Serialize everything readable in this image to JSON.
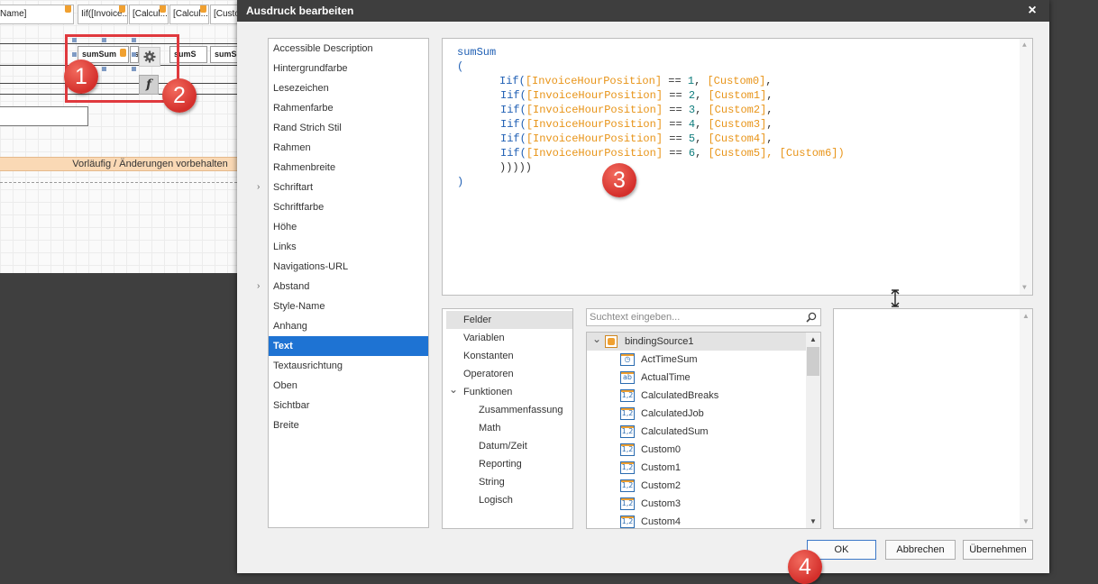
{
  "designer": {
    "header_cells": [
      "Name]",
      "Iif([Invoice...",
      "[Calcul...",
      "[Calcul...",
      "[Custo..."
    ],
    "detail_cells": [
      "sumSum",
      "s",
      "sumS",
      "sumS"
    ],
    "status_text": "Vorläufig / Änderungen vorbehalten",
    "func_label": "f"
  },
  "badges": [
    "1",
    "2",
    "3",
    "4"
  ],
  "dialog": {
    "title": "Ausdruck bearbeiten",
    "close_glyph": "×",
    "properties": [
      {
        "label": "Accessible Description",
        "expandable": false
      },
      {
        "label": "Hintergrundfarbe",
        "expandable": false
      },
      {
        "label": "Lesezeichen",
        "expandable": false
      },
      {
        "label": "Rahmenfarbe",
        "expandable": false
      },
      {
        "label": "Rand Strich Stil",
        "expandable": false
      },
      {
        "label": "Rahmen",
        "expandable": false
      },
      {
        "label": "Rahmenbreite",
        "expandable": false
      },
      {
        "label": "Schriftart",
        "expandable": true
      },
      {
        "label": "Schriftfarbe",
        "expandable": false
      },
      {
        "label": "Höhe",
        "expandable": false
      },
      {
        "label": "Links",
        "expandable": false
      },
      {
        "label": "Navigations-URL",
        "expandable": false
      },
      {
        "label": "Abstand",
        "expandable": true
      },
      {
        "label": "Style-Name",
        "expandable": false
      },
      {
        "label": "Anhang",
        "expandable": false
      },
      {
        "label": "Text",
        "expandable": false,
        "selected": true
      },
      {
        "label": "Textausrichtung",
        "expandable": false
      },
      {
        "label": "Oben",
        "expandable": false
      },
      {
        "label": "Sichtbar",
        "expandable": false
      },
      {
        "label": "Breite",
        "expandable": false
      }
    ],
    "expression": {
      "func_name": "sumSum",
      "open_paren": "(",
      "close_paren": ")",
      "iif_keyword": "Iif(",
      "position_field": "[InvoiceHourPosition]",
      "operator": " == ",
      "rows": [
        {
          "n": "1",
          "value": "[Custom0]",
          "suffix": ","
        },
        {
          "n": "2",
          "value": "[Custom1]",
          "suffix": ","
        },
        {
          "n": "3",
          "value": "[Custom2]",
          "suffix": ","
        },
        {
          "n": "4",
          "value": "[Custom3]",
          "suffix": ","
        },
        {
          "n": "5",
          "value": "[Custom4]",
          "suffix": ","
        },
        {
          "n": "6",
          "value": "[Custom5]",
          "suffix": ", [Custom6])"
        }
      ],
      "closing": ")))))"
    },
    "categories": [
      {
        "label": "Felder",
        "indent": 0,
        "selected": true
      },
      {
        "label": "Variablen",
        "indent": 0
      },
      {
        "label": "Konstanten",
        "indent": 0
      },
      {
        "label": "Operatoren",
        "indent": 0
      },
      {
        "label": "Funktionen",
        "indent": 0,
        "expanded": true
      },
      {
        "label": "Zusammenfassung",
        "indent": 1
      },
      {
        "label": "Math",
        "indent": 1
      },
      {
        "label": "Datum/Zeit",
        "indent": 1
      },
      {
        "label": "Reporting",
        "indent": 1
      },
      {
        "label": "String",
        "indent": 1
      },
      {
        "label": "Logisch",
        "indent": 1
      }
    ],
    "search": {
      "placeholder": "Suchtext eingeben..."
    },
    "tree": {
      "root": "bindingSource1",
      "fields": [
        {
          "label": "ActTimeSum",
          "icon": "clock"
        },
        {
          "label": "ActualTime",
          "icon": "ab"
        },
        {
          "label": "CalculatedBreaks",
          "icon": "1,2"
        },
        {
          "label": "CalculatedJob",
          "icon": "1,2"
        },
        {
          "label": "CalculatedSum",
          "icon": "1,2"
        },
        {
          "label": "Custom0",
          "icon": "1,2"
        },
        {
          "label": "Custom1",
          "icon": "1,2"
        },
        {
          "label": "Custom2",
          "icon": "1,2"
        },
        {
          "label": "Custom3",
          "icon": "1,2"
        },
        {
          "label": "Custom4",
          "icon": "1,2"
        }
      ]
    },
    "buttons": {
      "ok": "OK",
      "cancel": "Abbrechen",
      "apply": "Übernehmen"
    }
  },
  "colors": {
    "accent": "#1e73d3",
    "keyword": "#1f5fb4",
    "field": "#e89418",
    "badge": "#d42f2b"
  }
}
